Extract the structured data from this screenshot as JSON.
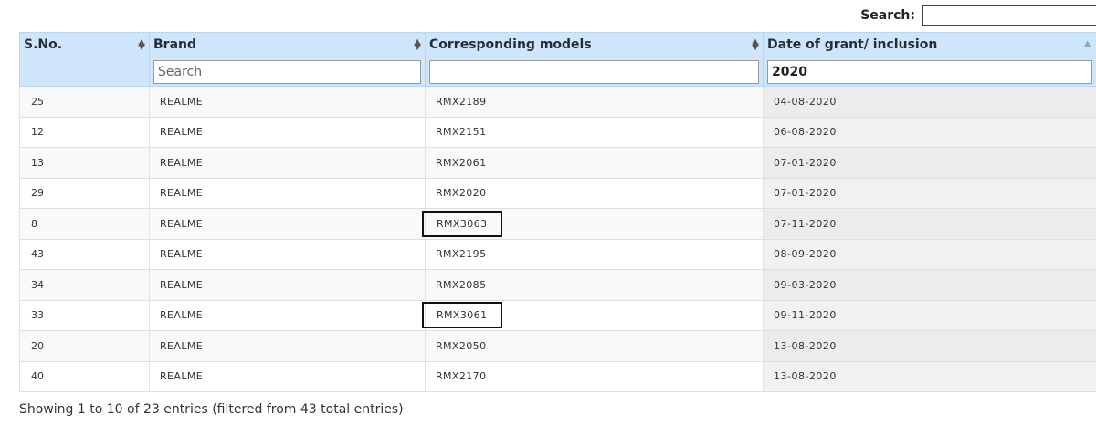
{
  "search": {
    "label": "Search:",
    "value": ""
  },
  "table": {
    "headers": [
      "S.No.",
      "Brand",
      "Corresponding models",
      "Date of grant/ inclusion"
    ],
    "filters": [
      {
        "value": "",
        "placeholder": "Search"
      },
      {
        "value": "",
        "placeholder": ""
      },
      {
        "value": "2020",
        "placeholder": ""
      }
    ],
    "rows": [
      {
        "sno": "25",
        "brand": "REALME",
        "model": "RMX2189",
        "date": "04-08-2020",
        "highlighted": false
      },
      {
        "sno": "12",
        "brand": "REALME",
        "model": "RMX2151",
        "date": "06-08-2020",
        "highlighted": false
      },
      {
        "sno": "13",
        "brand": "REALME",
        "model": "RMX2061",
        "date": "07-01-2020",
        "highlighted": false
      },
      {
        "sno": "29",
        "brand": "REALME",
        "model": "RMX2020",
        "date": "07-01-2020",
        "highlighted": false
      },
      {
        "sno": "8",
        "brand": "REALME",
        "model": "RMX3063",
        "date": "07-11-2020",
        "highlighted": true
      },
      {
        "sno": "43",
        "brand": "REALME",
        "model": "RMX2195",
        "date": "08-09-2020",
        "highlighted": false
      },
      {
        "sno": "34",
        "brand": "REALME",
        "model": "RMX2085",
        "date": "09-03-2020",
        "highlighted": false
      },
      {
        "sno": "33",
        "brand": "REALME",
        "model": "RMX3061",
        "date": "09-11-2020",
        "highlighted": true
      },
      {
        "sno": "20",
        "brand": "REALME",
        "model": "RMX2050",
        "date": "13-08-2020",
        "highlighted": false
      },
      {
        "sno": "40",
        "brand": "REALME",
        "model": "RMX2170",
        "date": "13-08-2020",
        "highlighted": false
      }
    ]
  },
  "info": "Showing 1 to 10 of 23 entries (filtered from 43 total entries)",
  "colors": {
    "header_bg": "#cfe5f9",
    "header_border": "#b9d6f2",
    "highlight_box": "#111111"
  },
  "icons": {
    "sort": "sort-both-icon",
    "sort_asc": "sort-asc-icon"
  }
}
